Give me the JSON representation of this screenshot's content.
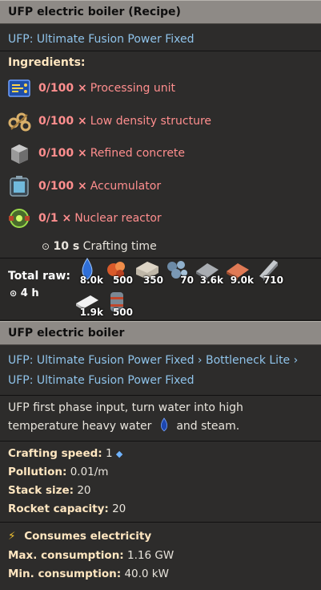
{
  "recipe": {
    "title": "UFP electric boiler (Recipe)",
    "mod": "UFP: Ultimate Fusion Power Fixed",
    "ingredients_title": "Ingredients:",
    "ingredients": [
      {
        "count": "0/100 ×",
        "name": "Processing unit",
        "icon": "processing-unit-icon"
      },
      {
        "count": "0/100 ×",
        "name": "Low density structure",
        "icon": "low-density-structure-icon"
      },
      {
        "count": "0/100 ×",
        "name": "Refined concrete",
        "icon": "refined-concrete-icon"
      },
      {
        "count": "0/100 ×",
        "name": "Accumulator",
        "icon": "accumulator-icon"
      },
      {
        "count": "0/1 ×",
        "name": "Nuclear reactor",
        "icon": "nuclear-reactor-icon"
      }
    ],
    "crafting_time_value": "10 s",
    "crafting_time_label": "Crafting time",
    "total_raw_label": "Total raw:",
    "total_raw_time": "4 h",
    "raw_items": [
      {
        "amount": "8.0k",
        "icon": "water-drop-icon"
      },
      {
        "amount": "500",
        "icon": "uranium-cell-icon"
      },
      {
        "amount": "350",
        "icon": "stone-brick-icon"
      },
      {
        "amount": "70",
        "icon": "iron-ore-icon"
      },
      {
        "amount": "3.6k",
        "icon": "iron-plate-icon"
      },
      {
        "amount": "9.0k",
        "icon": "copper-plate-icon"
      },
      {
        "amount": "710",
        "icon": "steel-plate-icon"
      },
      {
        "amount": "1.9k",
        "icon": "plastic-bar-icon"
      },
      {
        "amount": "500",
        "icon": "barrel-icon"
      }
    ]
  },
  "entity": {
    "title": "UFP electric boiler",
    "mods": "UFP: Ultimate Fusion Power Fixed › Bottleneck Lite › UFP: Ultimate Fusion Power Fixed",
    "description_1": "UFP first phase input, turn water into high temperature heavy water",
    "description_2": "and steam.",
    "stats": [
      {
        "label": "Crafting speed:",
        "value": "1"
      },
      {
        "label": "Pollution:",
        "value": "0.01/m"
      },
      {
        "label": "Stack size:",
        "value": "20"
      },
      {
        "label": "Rocket capacity:",
        "value": "20"
      }
    ],
    "electricity_title": "Consumes electricity",
    "max_label": "Max. consumption:",
    "max_value": "1.16 GW",
    "min_label": "Min. consumption:",
    "min_value": "40.0 kW"
  },
  "colors": {
    "header_bg": "#8e8a86",
    "link": "#8fc3ea",
    "missing_ingredient": "#ff8e8e",
    "heading": "#ffe6c0"
  }
}
